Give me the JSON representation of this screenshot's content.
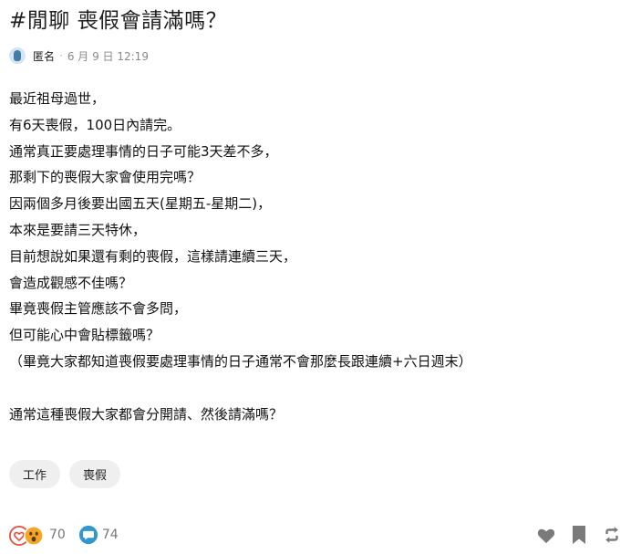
{
  "post": {
    "title": "#閒聊 喪假會請滿嗎？",
    "author": "匿名",
    "separator": "·",
    "date": "6 月 9 日 12:19",
    "lines": [
      "最近祖母過世，",
      "有6天喪假，100日內請完。",
      "通常真正要處理事情的日子可能3天差不多，",
      "那剩下的喪假大家會使用完嗎？",
      "因兩個多月後要出國五天(星期五-星期二)，",
      "本來是要請三天特休，",
      "目前想說如果還有剩的喪假，這樣請連續三天，",
      "會造成觀感不佳嗎？",
      "畢竟喪假主管應該不會多問，",
      "但可能心中會貼標籤嗎？",
      "（畢竟大家都知道喪假要處理事情的日子通常不會那麼長跟連續+六日週末）",
      "",
      "通常這種喪假大家都會分開請、然後請滿嗎？"
    ]
  },
  "tags": [
    "工作",
    "喪假"
  ],
  "footer": {
    "reactions_count": "70",
    "comments_count": "74",
    "icons": [
      "heart-reaction-icon",
      "surprised-reaction-icon",
      "comment-bubble-icon",
      "like-heart-icon",
      "bookmark-icon",
      "share-icon"
    ]
  },
  "colors": {
    "heart": "#e8523f",
    "surprised": "#f5a623",
    "comment": "#3397cf",
    "action_gray": "#7a7a7a",
    "avatar": "#3e7ea8"
  }
}
